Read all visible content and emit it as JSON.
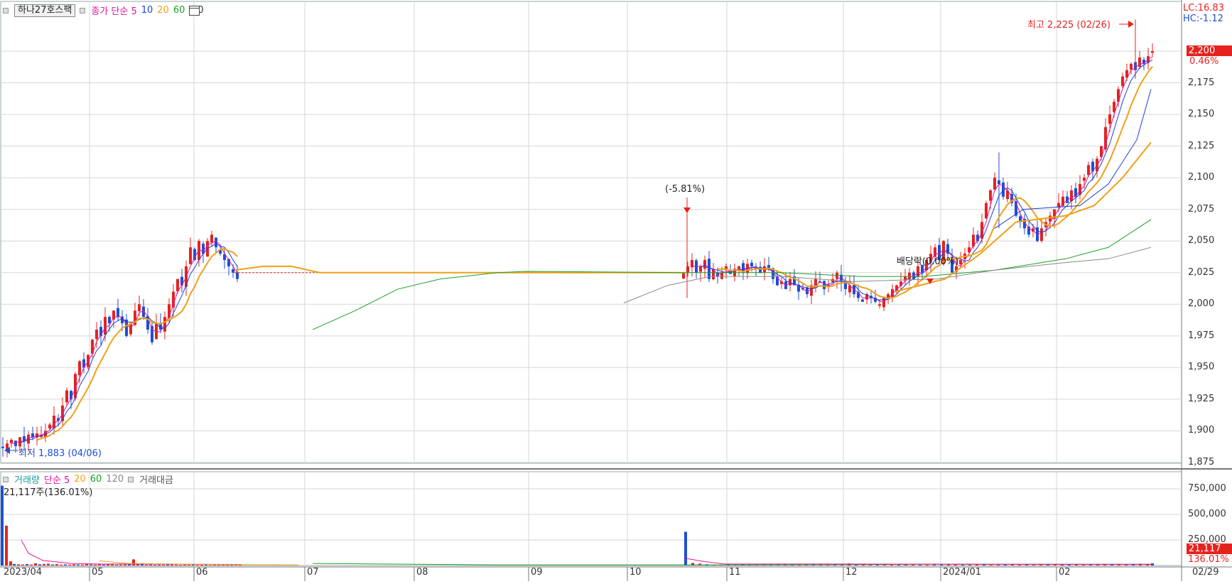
{
  "price_legend": {
    "name": "하나27호스팩",
    "items": [
      {
        "label": "종가 단순 5",
        "color": "#e0149b"
      },
      {
        "label": "10",
        "color": "#1e3fd0"
      },
      {
        "label": "20",
        "color": "#f0a018"
      },
      {
        "label": "60",
        "color": "#18a028"
      }
    ],
    "calendar_suffix": "0",
    "calendar_icon": "calendar-icon"
  },
  "volume_legend": {
    "items": [
      {
        "label": "거래량",
        "color": "#1a9a9a"
      },
      {
        "label": "단순 5",
        "color": "#e0149b"
      },
      {
        "label": "20",
        "color": "#f0a018"
      },
      {
        "label": "60",
        "color": "#18a028"
      },
      {
        "label": "120",
        "color": "#888888"
      },
      {
        "label": "거래대금",
        "color": "#555555"
      }
    ],
    "current": "21,117주(136.01%)"
  },
  "indicators": {
    "lc": "LC:16.83",
    "hc": "HC:-1.12"
  },
  "price_badge": {
    "value": "2,200",
    "change": "0.46%"
  },
  "volume_badge": {
    "value": "21,117",
    "change": "136.01%"
  },
  "annotations": {
    "high": "최고 2,225 (02/26)",
    "low": "최저 1,883 (04/06)",
    "drop": "(-5.81%)",
    "dividend": "배당락(0.00%)"
  },
  "price_axis": [
    "2,200",
    "2,175",
    "2,150",
    "2,125",
    "2,100",
    "2,075",
    "2,050",
    "2,025",
    "2,000",
    "1,975",
    "1,950",
    "1,925",
    "1,900",
    "1,875"
  ],
  "volume_axis": [
    "750,000",
    "500,000",
    "250,000"
  ],
  "time_axis": [
    "2023/04",
    "05",
    "06",
    "07",
    "08",
    "09",
    "10",
    "11",
    "12",
    "2024/01",
    "02",
    "02/29"
  ],
  "colors": {
    "up": "#e4231f",
    "down": "#1e4fd6",
    "ma5": "#e0149b",
    "ma10": "#1e3fd0",
    "ma20": "#f0a018",
    "ma60": "#18a028",
    "ma120": "#8a8a8a"
  },
  "chart_data": {
    "type": "candlestick",
    "y_range": [
      1875,
      2225
    ],
    "series_notes": "daily OHLC approximated from chart",
    "candles": [
      {
        "date": "2023-04-06",
        "o": 1890,
        "h": 1892,
        "l": 1883,
        "c": 1887
      },
      {
        "date": "2023-04-11",
        "o": 1893,
        "h": 1898,
        "l": 1886,
        "c": 1890
      },
      {
        "date": "2023-04-18",
        "o": 1888,
        "h": 1900,
        "l": 1886,
        "c": 1897
      },
      {
        "date": "2023-04-25",
        "o": 1900,
        "h": 1920,
        "l": 1895,
        "c": 1915
      },
      {
        "date": "2023-05-02",
        "o": 1918,
        "h": 1960,
        "l": 1910,
        "c": 1950
      },
      {
        "date": "2023-05-09",
        "o": 1955,
        "h": 1990,
        "l": 1945,
        "c": 1985
      },
      {
        "date": "2023-05-16",
        "o": 1990,
        "h": 2020,
        "l": 1960,
        "c": 1975
      },
      {
        "date": "2023-05-23",
        "o": 1975,
        "h": 1995,
        "l": 1960,
        "c": 1985
      },
      {
        "date": "2023-05-30",
        "o": 1990,
        "h": 2030,
        "l": 1980,
        "c": 2020
      },
      {
        "date": "2023-06-05",
        "o": 2030,
        "h": 2062,
        "l": 2015,
        "c": 2055
      },
      {
        "date": "2023-06-12",
        "o": 2058,
        "h": 2060,
        "l": 2020,
        "c": 2035
      },
      {
        "date": "2023-06-19",
        "o": 2035,
        "h": 2040,
        "l": 2015,
        "c": 2020
      },
      {
        "date": "2023-10-20",
        "o": 2025,
        "h": 2073,
        "l": 2005,
        "c": 2030
      },
      {
        "date": "2023-11-15",
        "o": 2030,
        "h": 2040,
        "l": 2015,
        "c": 2022
      },
      {
        "date": "2023-12-12",
        "o": 2010,
        "h": 2020,
        "l": 1985,
        "c": 1995
      },
      {
        "date": "2023-12-28",
        "o": 2000,
        "h": 2040,
        "l": 1995,
        "c": 2030
      },
      {
        "date": "2024-01-10",
        "o": 2060,
        "h": 2110,
        "l": 2050,
        "c": 2100
      },
      {
        "date": "2024-01-22",
        "o": 2075,
        "h": 2090,
        "l": 2035,
        "c": 2060
      },
      {
        "date": "2024-02-05",
        "o": 2075,
        "h": 2100,
        "l": 2065,
        "c": 2090
      },
      {
        "date": "2024-02-16",
        "o": 2120,
        "h": 2175,
        "l": 2110,
        "c": 2170
      },
      {
        "date": "2024-02-26",
        "o": 2200,
        "h": 2225,
        "l": 2185,
        "c": 2195
      },
      {
        "date": "2024-02-29",
        "o": 2195,
        "h": 2205,
        "l": 2188,
        "c": 2200
      }
    ],
    "ma_periods": [
      5,
      10,
      20,
      60,
      120
    ],
    "volume_peak": 780000,
    "volume_latest": 21117
  }
}
